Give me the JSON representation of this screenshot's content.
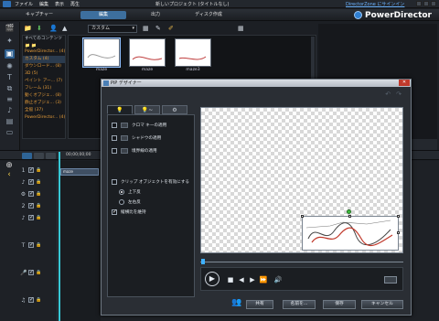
{
  "menubar": {
    "file": "ファイル",
    "edit": "編集",
    "view": "表示",
    "playback": "再生"
  },
  "window_title": "新しいプロジェクト (タイトルなし)",
  "directorzone_link": "DirectorZone にサインイン",
  "brand": "PowerDirector",
  "modes": {
    "capture": "キャプチャー",
    "edit": "編集",
    "produce": "出力",
    "disc": "ディスク作成"
  },
  "library": {
    "filter": "カスタム",
    "tree": [
      "すべてのコンテンツ",
      "PowerDirector... (4)",
      "カスタム (4)",
      "ダウンロード... (8)",
      "3D (5)",
      "ペイント アー... (7)",
      "フレーム (31)",
      "動くオブジェ... (8)",
      "静止オブジェ... (3)",
      "全般 (37)",
      "PowerDirector... (4)"
    ],
    "thumbs": [
      "maze",
      "maze",
      "maze3"
    ]
  },
  "timeline": {
    "timecode": "00;00;00;00",
    "clip_label": "maze"
  },
  "dialog": {
    "title": "PiP デザイナー",
    "tab_labels": [
      "💡",
      "💡~",
      "⚙"
    ],
    "options": {
      "chroma": "クロマ キーの適用",
      "shadow": "シャドウの適用",
      "border": "境界線の適用",
      "flip": "クリップ オブジェクトを有効にする",
      "updown": "上下反",
      "leftright": "左右反",
      "aspect": "縦横比を維持"
    },
    "buttons": {
      "share": "共有",
      "save_as": "名前を...",
      "save": "保存",
      "cancel": "キャンセル"
    }
  },
  "colors": {
    "accent": "#3fb0ff",
    "playhead": "#38c8d6",
    "tab_active": "#3d6f9e"
  }
}
